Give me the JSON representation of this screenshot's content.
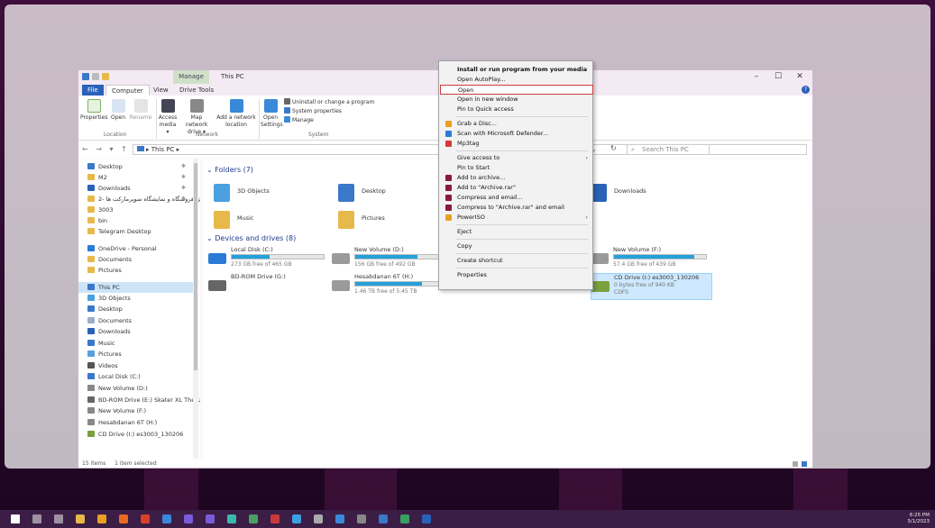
{
  "window": {
    "title": "This PC",
    "manage_tab": "Manage",
    "minimize": "–",
    "maximize": "☐",
    "close": "✕",
    "tabs": [
      "File",
      "Computer",
      "View",
      "Drive Tools"
    ]
  },
  "ribbon": {
    "properties": "Properties",
    "open": "Open",
    "rename": "Rename",
    "access_media": "Access media ▾",
    "map_network_drive": "Map network drive ▾",
    "add_network_location": "Add a network location",
    "open_settings": "Open Settings",
    "uninstall": "Uninstall or change a program",
    "system_properties": "System properties",
    "manage": "Manage",
    "groups": {
      "location": "Location",
      "network": "Network",
      "system": "System"
    }
  },
  "address": {
    "nav_arrows": "←  →  ▾  ↑",
    "path": "▸ This PC ▸",
    "search_placeholder": "Search This PC"
  },
  "nav_pane": [
    {
      "label": "Desktop",
      "icon": "desktop-icon",
      "color": "#3a78c9",
      "pinned": true
    },
    {
      "label": "M2",
      "icon": "folder-icon",
      "color": "#e7b94a",
      "pinned": true
    },
    {
      "label": "Downloads",
      "icon": "download-icon",
      "color": "#2a62b8",
      "pinned": true
    },
    {
      "label": "2- همایش فروشگاه و نمایشگاه سوپرمارکت ها",
      "icon": "folder-icon",
      "color": "#e7b94a",
      "pinned": true
    },
    {
      "label": "3003",
      "icon": "folder-icon",
      "color": "#e7b94a",
      "pinned": false
    },
    {
      "label": "bin",
      "icon": "folder-icon",
      "color": "#e7b94a",
      "pinned": false
    },
    {
      "label": "Telegram Desktop",
      "icon": "folder-icon",
      "color": "#e7b94a",
      "pinned": false
    },
    {
      "label": "OneDrive - Personal",
      "icon": "cloud-icon",
      "color": "#2a7bd6",
      "pinned": false
    },
    {
      "label": "Documents",
      "icon": "folder-icon",
      "color": "#e7b94a",
      "pinned": false
    },
    {
      "label": "Pictures",
      "icon": "folder-icon",
      "color": "#e7b94a",
      "pinned": false
    },
    {
      "label": "This PC",
      "icon": "pc-icon",
      "color": "#3a78c9",
      "pinned": false
    },
    {
      "label": "3D Objects",
      "icon": "cube-icon",
      "color": "#4aa0e0",
      "pinned": false
    },
    {
      "label": "Desktop",
      "icon": "desktop-icon",
      "color": "#3a78c9",
      "pinned": false
    },
    {
      "label": "Documents",
      "icon": "document-icon",
      "color": "#9ab0c8",
      "pinned": false
    },
    {
      "label": "Downloads",
      "icon": "download-icon",
      "color": "#2a62b8",
      "pinned": false
    },
    {
      "label": "Music",
      "icon": "music-icon",
      "color": "#3a78c9",
      "pinned": false
    },
    {
      "label": "Pictures",
      "icon": "picture-icon",
      "color": "#5aa0d8",
      "pinned": false
    },
    {
      "label": "Videos",
      "icon": "video-icon",
      "color": "#555555",
      "pinned": false
    },
    {
      "label": "Local Disk (C:)",
      "icon": "drive-icon",
      "color": "#3a78c9",
      "pinned": false
    },
    {
      "label": "New Volume (D:)",
      "icon": "drive-icon",
      "color": "#888888",
      "pinned": false
    },
    {
      "label": "BD-ROM Drive (E:) Skater XL The U",
      "icon": "disc-drive-icon",
      "color": "#666666",
      "pinned": false
    },
    {
      "label": "New Volume (F:)",
      "icon": "drive-icon",
      "color": "#888888",
      "pinned": false
    },
    {
      "label": "Hesabdanan 6T (H:)",
      "icon": "drive-icon",
      "color": "#888888",
      "pinned": false
    },
    {
      "label": "CD Drive (I:) es3003_130206",
      "icon": "cd-icon",
      "color": "#7aa040",
      "pinned": false
    }
  ],
  "folders_section": {
    "header": "Folders (7)",
    "items": [
      {
        "label": "3D Objects",
        "icon": "cube-folder-icon",
        "color": "#4aa0e0"
      },
      {
        "label": "Desktop",
        "icon": "desktop-folder-icon",
        "color": "#3a78c9"
      },
      {
        "label": "Downloads",
        "icon": "download-folder-icon",
        "color": "#2a62b8"
      },
      {
        "label": "Music",
        "icon": "music-folder-icon",
        "color": "#e7b94a"
      },
      {
        "label": "Pictures",
        "icon": "picture-folder-icon",
        "color": "#e7b94a"
      }
    ]
  },
  "drives_section": {
    "header": "Devices and drives (8)",
    "items": [
      {
        "label": "Local Disk (C:)",
        "free": "273 GB free of 465 GB",
        "used_fraction": 0.41,
        "icon": "windows-drive-icon"
      },
      {
        "label": "New Volume (D:)",
        "free": "156 GB free of 492 GB",
        "used_fraction": 0.68,
        "icon": "drive-icon"
      },
      {
        "label": "New Volume (F:)",
        "free": "57.4 GB free of 439 GB",
        "used_fraction": 0.87,
        "icon": "drive-icon"
      },
      {
        "label": "BD-ROM Drive (G:)",
        "free": "",
        "used_fraction": null,
        "icon": "bd-icon"
      },
      {
        "label": "Hesabdanan 6T (H:)",
        "free": "1.46 TB free of 5.45 TB",
        "used_fraction": 0.73,
        "icon": "drive-icon"
      },
      {
        "label": "CD Drive (I:) es3003_130206",
        "free": "0 bytes free of 940 KB",
        "extra": "CDFS",
        "used_fraction": null,
        "icon": "cd-icon"
      }
    ]
  },
  "status": {
    "items": "15 items",
    "selected": "1 item selected"
  },
  "context_menu": {
    "items": [
      {
        "label": "Install or run program from your media",
        "bold": true
      },
      {
        "label": "Open AutoPlay..."
      },
      {
        "label": "Open",
        "highlighted": true
      },
      {
        "label": "Open in new window"
      },
      {
        "label": "Pin to Quick access"
      },
      {
        "sep": true
      },
      {
        "label": "Grab a Disc...",
        "icon_color": "#e8a020"
      },
      {
        "label": "Scan with Microsoft Defender...",
        "icon_color": "#2a7bd6"
      },
      {
        "label": "Mp3tag",
        "icon_color": "#d63a3a"
      },
      {
        "sep": true
      },
      {
        "label": "Give access to",
        "submenu": true
      },
      {
        "label": "Pin to Start"
      },
      {
        "label": "Add to archive...",
        "icon_color": "#8a1a3a"
      },
      {
        "label": "Add to \"Archive.rar\"",
        "icon_color": "#8a1a3a"
      },
      {
        "label": "Compress and email...",
        "icon_color": "#8a1a3a"
      },
      {
        "label": "Compress to \"Archive.rar\" and email",
        "icon_color": "#8a1a3a"
      },
      {
        "label": "PowerISO",
        "icon_color": "#e8a020",
        "submenu": true
      },
      {
        "sep": true
      },
      {
        "label": "Eject"
      },
      {
        "sep": true
      },
      {
        "label": "Copy"
      },
      {
        "sep": true
      },
      {
        "label": "Create shortcut"
      },
      {
        "sep": true
      },
      {
        "label": "Properties"
      }
    ]
  },
  "taskbar": {
    "time": "6:25 PM",
    "date": "3/1/2023",
    "apps": [
      {
        "icon": "windows-icon",
        "color": "#ffffff"
      },
      {
        "icon": "search-icon",
        "color": "#dddddd"
      },
      {
        "icon": "task-view-icon",
        "color": "#dddddd"
      },
      {
        "icon": "file-explorer-icon",
        "color": "#e7b94a"
      },
      {
        "icon": "chrome-icon",
        "color": "#e8a020"
      },
      {
        "icon": "firefox-icon",
        "color": "#e86a20"
      },
      {
        "icon": "illustrator-icon",
        "color": "#d8402a"
      },
      {
        "icon": "photoshop-icon",
        "color": "#3a88d8"
      },
      {
        "icon": "premiere-icon",
        "color": "#7a5ad8"
      },
      {
        "icon": "after-effects-icon",
        "color": "#7a5ad8"
      },
      {
        "icon": "audition-icon",
        "color": "#3ab8a8"
      },
      {
        "icon": "app-icon",
        "color": "#4aa060"
      },
      {
        "icon": "filezilla-icon",
        "color": "#c83a3a"
      },
      {
        "icon": "telegram-icon",
        "color": "#3aa0e0"
      },
      {
        "icon": "settings-icon",
        "color": "#aaaaaa"
      },
      {
        "icon": "app-icon-2",
        "color": "#3a8ad8"
      },
      {
        "icon": "app-icon-3",
        "color": "#888888"
      },
      {
        "icon": "app-icon-4",
        "color": "#3a78c9"
      },
      {
        "icon": "app-icon-5",
        "color": "#3aa060"
      },
      {
        "icon": "word-icon",
        "color": "#2a62b8"
      }
    ]
  }
}
